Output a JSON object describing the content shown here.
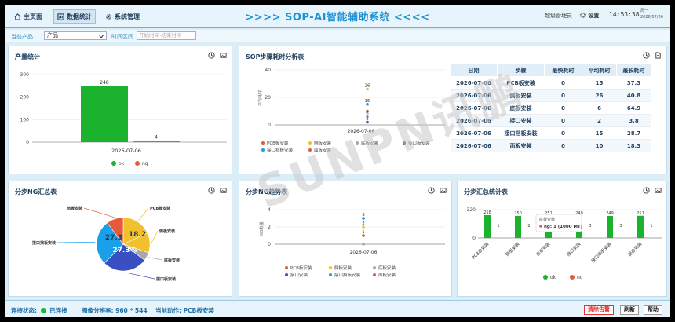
{
  "nav": {
    "home": "主页面",
    "stats": "数据统计",
    "sysmgr": "系统管理"
  },
  "title": ">>>> SOP-AI智能辅助系统 <<<<",
  "user": "超级管理员",
  "settings": "设置",
  "time": "14:53:38",
  "weekday": "周一",
  "date": "2026/07/06",
  "filter": {
    "product_label": "当前产品",
    "product_value": "产品",
    "range_label": "时间区间",
    "range_placeholder": "开始时间-结束时间"
  },
  "panels": {
    "output": "产量统计",
    "sop_time": "SOP步骤耗时分析表",
    "ng_summary": "分步NG汇总表",
    "ng_trend": "分步NG趋势表",
    "step_summary": "分步汇总统计表"
  },
  "output_chart": {
    "type": "bar",
    "categories": [
      "2026-07-06"
    ],
    "series": [
      {
        "name": "ok",
        "values": [
          248
        ],
        "color": "#1bb22e"
      },
      {
        "name": "ng",
        "values": [
          4
        ],
        "color": "#e8593a"
      }
    ],
    "ylim": [
      0,
      300
    ],
    "yticks": [
      "300",
      "200",
      "100",
      "0"
    ]
  },
  "sop_chart": {
    "type": "scatter",
    "ylabel": "平均耗时",
    "x": "2026-07-06",
    "yticks": [
      "40",
      "20",
      "0"
    ],
    "labels": [
      "26",
      "15",
      "6",
      "2"
    ],
    "legend": [
      "PCB板安装",
      "侧板安装",
      "底板安装",
      "接口板安装",
      "接口挡板安装",
      "面板安装"
    ]
  },
  "sop_table": {
    "headers": [
      "日期",
      "步骤",
      "最快耗时",
      "平均耗时",
      "最长耗时"
    ],
    "rows": [
      [
        "2026-07-06",
        "PCB板安装",
        "0",
        "15",
        "37.3"
      ],
      [
        "2026-07-06",
        "侧板安装",
        "0",
        "26",
        "40.8"
      ],
      [
        "2026-07-06",
        "底板安装",
        "0",
        "6",
        "64.9"
      ],
      [
        "2026-07-06",
        "接口安装",
        "0",
        "2",
        "3.8"
      ],
      [
        "2026-07-06",
        "接口挡板安装",
        "0",
        "15",
        "28.7"
      ],
      [
        "2026-07-06",
        "面板安装",
        "0",
        "10",
        "18.3"
      ]
    ]
  },
  "ng_pie": {
    "type": "pie",
    "labels": [
      "PCB板安装",
      "侧板安装",
      "底板安装",
      "接口板安装",
      "接口挡板安装",
      "面板安装"
    ],
    "values": [
      18.2,
      12,
      5,
      27.3,
      27.3,
      10.2
    ],
    "colors": [
      "#f2c02c",
      "#f2c02c",
      "#a8a8a8",
      "#3a4fc2",
      "#1aa0e8",
      "#e8593a"
    ],
    "pct_labels": [
      "27.3",
      "18.2",
      "27.3%"
    ]
  },
  "ng_trend": {
    "type": "scatter",
    "ylabel": "NG数量",
    "x": "2026-07-06",
    "yticks": [
      "4",
      "2",
      "0"
    ],
    "labels": [
      "3",
      "2",
      "1"
    ],
    "legend": [
      "PCB板安装",
      "侧板安装",
      "底板安装",
      "接口安装",
      "接口挡板安装",
      "面板安装"
    ]
  },
  "step_chart": {
    "type": "bar",
    "categories": [
      "PCB板安装",
      "侧板安装",
      "底板安装",
      "接口安装",
      "接口挡板安装",
      "面板安装"
    ],
    "series": [
      {
        "name": "ok",
        "values": [
          258,
          250,
          251,
          249,
          249,
          251
        ]
      },
      {
        "name": "ng",
        "values": [
          1,
          2,
          0,
          3,
          3,
          1
        ]
      }
    ],
    "ok_labels": [
      "258",
      "250",
      "251",
      "249",
      "249",
      "251"
    ],
    "ng_labels": [
      "1",
      "2",
      "0",
      "3",
      "3",
      "1"
    ],
    "ylim": [
      0,
      320
    ],
    "yticks": [
      "320",
      "0"
    ],
    "tooltip_title": "底板安装",
    "tooltip_text": "ng: 1 (1000 MT)",
    "legend": [
      "ok",
      "ng"
    ]
  },
  "status": {
    "conn_label": "连接状态:",
    "conn_value": "已连接",
    "res_label": "图像分辨率:",
    "res_value": "960 * 544",
    "action_label": "当前动作:",
    "action_value": "PCB板安装",
    "clear": "清除告警",
    "refresh": "刷新",
    "help": "帮助"
  },
  "watermark": "SUNPN讯鹏"
}
